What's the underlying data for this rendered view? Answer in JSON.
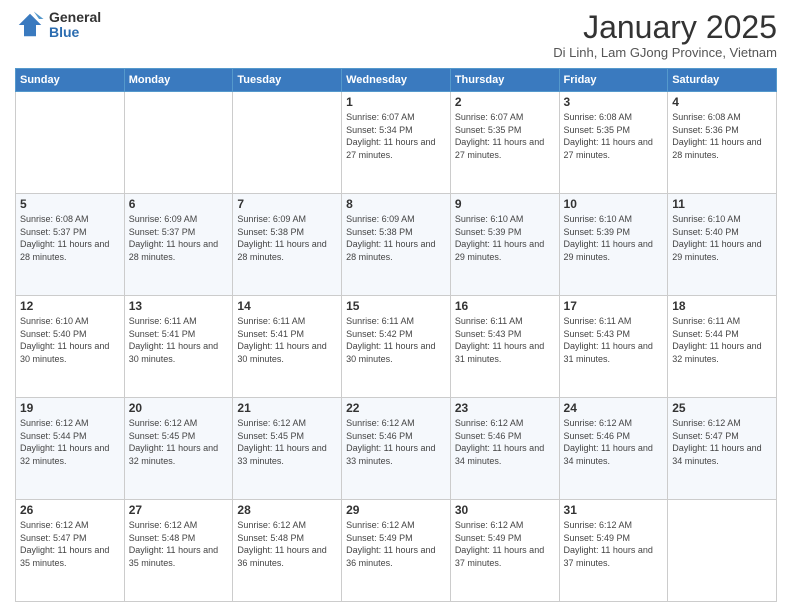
{
  "logo": {
    "general": "General",
    "blue": "Blue"
  },
  "header": {
    "month": "January 2025",
    "location": "Di Linh, Lam GJong Province, Vietnam"
  },
  "weekdays": [
    "Sunday",
    "Monday",
    "Tuesday",
    "Wednesday",
    "Thursday",
    "Friday",
    "Saturday"
  ],
  "weeks": [
    [
      {
        "day": null,
        "sunrise": null,
        "sunset": null,
        "daylight": null
      },
      {
        "day": null,
        "sunrise": null,
        "sunset": null,
        "daylight": null
      },
      {
        "day": null,
        "sunrise": null,
        "sunset": null,
        "daylight": null
      },
      {
        "day": "1",
        "sunrise": "6:07 AM",
        "sunset": "5:34 PM",
        "daylight": "11 hours and 27 minutes."
      },
      {
        "day": "2",
        "sunrise": "6:07 AM",
        "sunset": "5:35 PM",
        "daylight": "11 hours and 27 minutes."
      },
      {
        "day": "3",
        "sunrise": "6:08 AM",
        "sunset": "5:35 PM",
        "daylight": "11 hours and 27 minutes."
      },
      {
        "day": "4",
        "sunrise": "6:08 AM",
        "sunset": "5:36 PM",
        "daylight": "11 hours and 28 minutes."
      }
    ],
    [
      {
        "day": "5",
        "sunrise": "6:08 AM",
        "sunset": "5:37 PM",
        "daylight": "11 hours and 28 minutes."
      },
      {
        "day": "6",
        "sunrise": "6:09 AM",
        "sunset": "5:37 PM",
        "daylight": "11 hours and 28 minutes."
      },
      {
        "day": "7",
        "sunrise": "6:09 AM",
        "sunset": "5:38 PM",
        "daylight": "11 hours and 28 minutes."
      },
      {
        "day": "8",
        "sunrise": "6:09 AM",
        "sunset": "5:38 PM",
        "daylight": "11 hours and 28 minutes."
      },
      {
        "day": "9",
        "sunrise": "6:10 AM",
        "sunset": "5:39 PM",
        "daylight": "11 hours and 29 minutes."
      },
      {
        "day": "10",
        "sunrise": "6:10 AM",
        "sunset": "5:39 PM",
        "daylight": "11 hours and 29 minutes."
      },
      {
        "day": "11",
        "sunrise": "6:10 AM",
        "sunset": "5:40 PM",
        "daylight": "11 hours and 29 minutes."
      }
    ],
    [
      {
        "day": "12",
        "sunrise": "6:10 AM",
        "sunset": "5:40 PM",
        "daylight": "11 hours and 30 minutes."
      },
      {
        "day": "13",
        "sunrise": "6:11 AM",
        "sunset": "5:41 PM",
        "daylight": "11 hours and 30 minutes."
      },
      {
        "day": "14",
        "sunrise": "6:11 AM",
        "sunset": "5:41 PM",
        "daylight": "11 hours and 30 minutes."
      },
      {
        "day": "15",
        "sunrise": "6:11 AM",
        "sunset": "5:42 PM",
        "daylight": "11 hours and 30 minutes."
      },
      {
        "day": "16",
        "sunrise": "6:11 AM",
        "sunset": "5:43 PM",
        "daylight": "11 hours and 31 minutes."
      },
      {
        "day": "17",
        "sunrise": "6:11 AM",
        "sunset": "5:43 PM",
        "daylight": "11 hours and 31 minutes."
      },
      {
        "day": "18",
        "sunrise": "6:11 AM",
        "sunset": "5:44 PM",
        "daylight": "11 hours and 32 minutes."
      }
    ],
    [
      {
        "day": "19",
        "sunrise": "6:12 AM",
        "sunset": "5:44 PM",
        "daylight": "11 hours and 32 minutes."
      },
      {
        "day": "20",
        "sunrise": "6:12 AM",
        "sunset": "5:45 PM",
        "daylight": "11 hours and 32 minutes."
      },
      {
        "day": "21",
        "sunrise": "6:12 AM",
        "sunset": "5:45 PM",
        "daylight": "11 hours and 33 minutes."
      },
      {
        "day": "22",
        "sunrise": "6:12 AM",
        "sunset": "5:46 PM",
        "daylight": "11 hours and 33 minutes."
      },
      {
        "day": "23",
        "sunrise": "6:12 AM",
        "sunset": "5:46 PM",
        "daylight": "11 hours and 34 minutes."
      },
      {
        "day": "24",
        "sunrise": "6:12 AM",
        "sunset": "5:46 PM",
        "daylight": "11 hours and 34 minutes."
      },
      {
        "day": "25",
        "sunrise": "6:12 AM",
        "sunset": "5:47 PM",
        "daylight": "11 hours and 34 minutes."
      }
    ],
    [
      {
        "day": "26",
        "sunrise": "6:12 AM",
        "sunset": "5:47 PM",
        "daylight": "11 hours and 35 minutes."
      },
      {
        "day": "27",
        "sunrise": "6:12 AM",
        "sunset": "5:48 PM",
        "daylight": "11 hours and 35 minutes."
      },
      {
        "day": "28",
        "sunrise": "6:12 AM",
        "sunset": "5:48 PM",
        "daylight": "11 hours and 36 minutes."
      },
      {
        "day": "29",
        "sunrise": "6:12 AM",
        "sunset": "5:49 PM",
        "daylight": "11 hours and 36 minutes."
      },
      {
        "day": "30",
        "sunrise": "6:12 AM",
        "sunset": "5:49 PM",
        "daylight": "11 hours and 37 minutes."
      },
      {
        "day": "31",
        "sunrise": "6:12 AM",
        "sunset": "5:49 PM",
        "daylight": "11 hours and 37 minutes."
      },
      {
        "day": null,
        "sunrise": null,
        "sunset": null,
        "daylight": null
      }
    ]
  ],
  "labels": {
    "sunrise": "Sunrise:",
    "sunset": "Sunset:",
    "daylight": "Daylight:"
  }
}
